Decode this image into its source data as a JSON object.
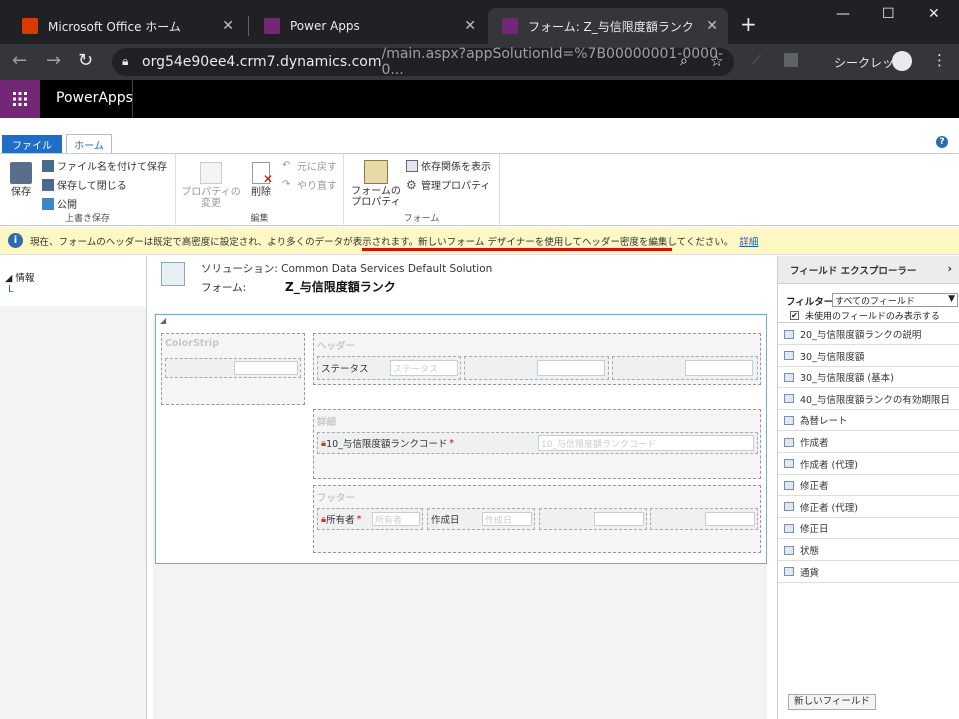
{
  "browser": {
    "tabs": [
      {
        "title": "Microsoft Office ホーム"
      },
      {
        "title": "Power Apps"
      },
      {
        "title": "フォーム: Z_与信限度額ランク"
      }
    ],
    "url_host": "org54e90ee4.crm7.dynamics.com",
    "url_rest": "/main.aspx?appSolutionId=%7B00000001-0000-0...",
    "incognito_label": "シークレット"
  },
  "app": {
    "name": "PowerApps"
  },
  "ribbon": {
    "file_tab": "ファイル",
    "home_tab": "ホーム",
    "save": "保存",
    "save_as": "ファイル名を付けて保存",
    "save_close": "保存して閉じる",
    "publish": "公開",
    "group_save": "上書き保存",
    "props_change_1": "プロパティの",
    "props_change_2": "変更",
    "delete": "削除",
    "undo": "元に戻す",
    "redo": "やり直す",
    "group_edit": "編集",
    "form_props_1": "フォームの",
    "form_props_2": "プロパティ",
    "show_deps": "依存関係を表示",
    "managed_props": "管理プロパティ",
    "group_form": "フォーム"
  },
  "infobar": {
    "text1": "現在、フォームのヘッダーは既定で高密度に設定され、より多くのデータが表示されます。",
    "text2": "新しいフォーム デザイナーを使用してヘッダー密度を編集してください。",
    "link": "詳細"
  },
  "left": {
    "section": "情報",
    "item": "L"
  },
  "form_header": {
    "solution_label": "ソリューション:",
    "solution_value": "Common Data Services Default Solution",
    "form_label": "フォーム:",
    "form_value": "Z_与信限度額ランク"
  },
  "form": {
    "colorstrip": "ColorStrip",
    "header": "ヘッダー",
    "status_label": "ステータス",
    "status_placeholder": "ステータス",
    "details": "詳細",
    "code_label": "10_与信限度額ランクコード",
    "code_placeholder": "10_与信限度額ランクコード",
    "footer": "フッター",
    "owner_label": "所有者",
    "owner_placeholder": "所有者",
    "created_label": "作成日",
    "created_placeholder": "作成日",
    "required_mark": "*"
  },
  "field_explorer": {
    "title": "フィールド エクスプローラー",
    "filter_label": "フィルター",
    "filter_value": "すべてのフィールド",
    "unused_only": "未使用のフィールドのみ表示する",
    "fields": [
      "20_与信限度額ランクの説明",
      "30_与信限度額",
      "30_与信限度額 (基本)",
      "40_与信限度額ランクの有効期限日",
      "為替レート",
      "作成者",
      "作成者 (代理)",
      "修正者",
      "修正者 (代理)",
      "修正日",
      "状態",
      "通貨"
    ],
    "new_field": "新しいフィールド"
  }
}
